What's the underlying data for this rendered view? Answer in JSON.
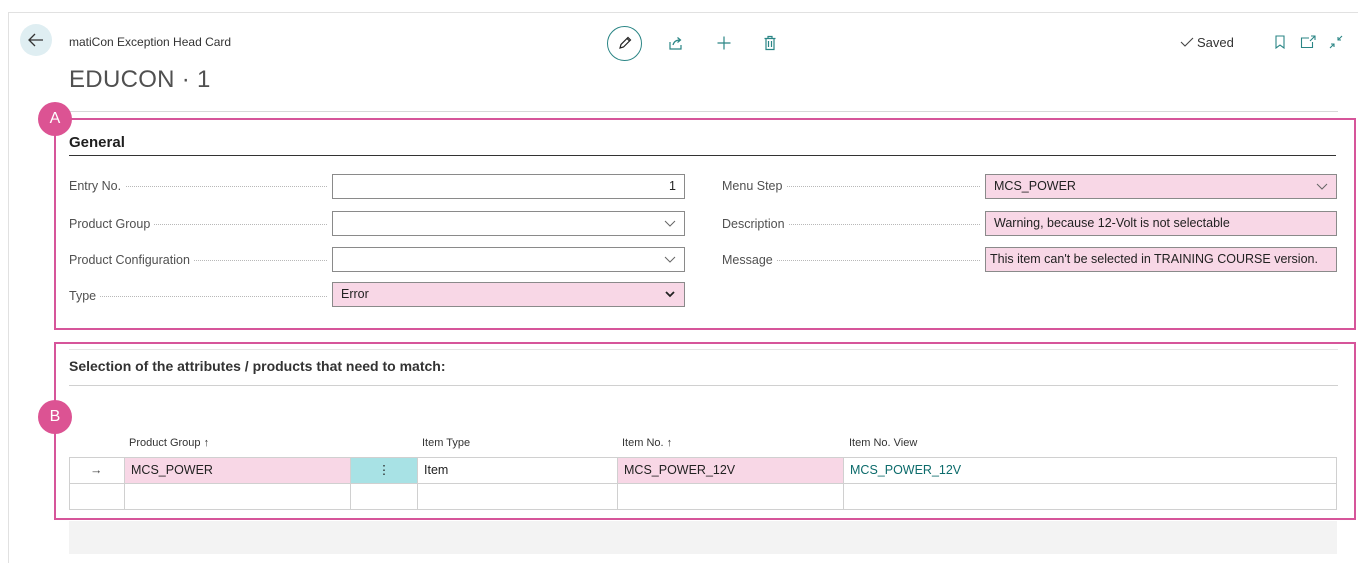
{
  "header": {
    "breadcrumb": "matiCon Exception Head Card",
    "title": "EDUCON · 1",
    "saved_label": "Saved"
  },
  "annotations": {
    "a": "A",
    "b": "B"
  },
  "general": {
    "title": "General",
    "left_fields": [
      {
        "label": "Entry No.",
        "value": "1"
      },
      {
        "label": "Product Group",
        "value": ""
      },
      {
        "label": "Product Configuration",
        "value": ""
      },
      {
        "label": "Type",
        "value": "Error"
      }
    ],
    "right_fields": [
      {
        "label": "Menu Step",
        "value": "MCS_POWER"
      },
      {
        "label": "Description",
        "value": "Warning, because 12-Volt is not selectable"
      },
      {
        "label": "Message",
        "value": "This item can't be selected in TRAINING COURSE version."
      }
    ]
  },
  "selection": {
    "title": "Selection of the attributes / products that need to match:",
    "columns": [
      "Product Group ↑",
      "Item Type",
      "Item No. ↑",
      "Item No. View"
    ],
    "rows": [
      {
        "arrow": "→",
        "product_group": "MCS_POWER",
        "menu": "⋮",
        "item_type": "Item",
        "item_no": "MCS_POWER_12V",
        "item_no_view": "MCS_POWER_12V"
      }
    ]
  },
  "colors": {
    "accent": "#2a8585",
    "annotation": "#dc5393",
    "highlight": "#f8d7e6",
    "selected_cell": "#a8e2e5"
  },
  "icons": [
    "back-arrow-icon",
    "edit-pencil-icon",
    "share-icon",
    "plus-icon",
    "trash-icon",
    "check-icon",
    "bookmark-icon",
    "open-new-window-icon",
    "collapse-icon",
    "chevron-down-icon"
  ]
}
